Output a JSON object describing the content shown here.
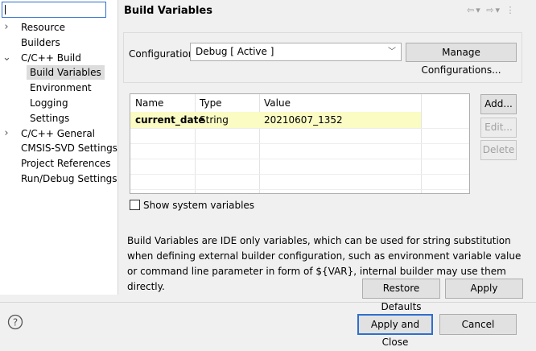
{
  "tree": {
    "items": [
      {
        "label": "Resource",
        "twisty": ">",
        "indent": 0
      },
      {
        "label": "Builders",
        "twisty": "",
        "indent": 0
      },
      {
        "label": "C/C++ Build",
        "twisty": "v",
        "indent": 0
      },
      {
        "label": "Build Variables",
        "twisty": "",
        "indent": 1,
        "selected": true
      },
      {
        "label": "Environment",
        "twisty": "",
        "indent": 1
      },
      {
        "label": "Logging",
        "twisty": "",
        "indent": 1
      },
      {
        "label": "Settings",
        "twisty": "",
        "indent": 1
      },
      {
        "label": "C/C++ General",
        "twisty": ">",
        "indent": 0
      },
      {
        "label": "CMSIS-SVD Settings",
        "twisty": "",
        "indent": 0
      },
      {
        "label": "Project References",
        "twisty": "",
        "indent": 0
      },
      {
        "label": "Run/Debug Settings",
        "twisty": "",
        "indent": 0
      }
    ]
  },
  "page": {
    "title": "Build Variables"
  },
  "config": {
    "label": "Configuration:",
    "value": "Debug  [ Active ]",
    "manage_label": "Manage Configurations..."
  },
  "table": {
    "columns": [
      "Name",
      "Type",
      "Value"
    ],
    "rows": [
      {
        "name": "current_date",
        "type": "String",
        "value": "20210607_1352"
      }
    ]
  },
  "buttons": {
    "add": "Add...",
    "edit": "Edit...",
    "delete": "Delete",
    "restore": "Restore Defaults",
    "apply": "Apply",
    "apply_close": "Apply and Close",
    "cancel": "Cancel"
  },
  "checkbox": {
    "label": "Show system variables"
  },
  "description": "Build Variables are IDE only variables, which can be used for string substitution when defining external builder configuration, such as environment variable value or command line parameter in form of ${VAR}, internal builder may use them directly.",
  "colors": {
    "accent": "#2e6fcf",
    "row_highlight": "#fbfbc4",
    "selection": "#dcdcdc"
  }
}
